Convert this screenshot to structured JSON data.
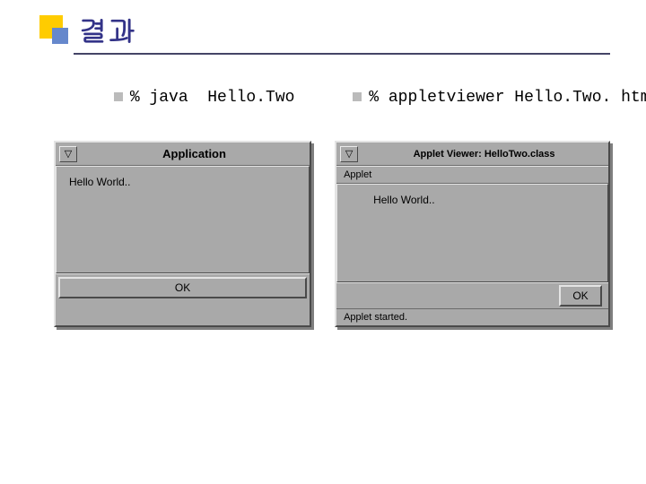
{
  "title": "결과",
  "commands": {
    "left": "% java  Hello.Two",
    "right": "% appletviewer Hello.Two. html"
  },
  "leftWindow": {
    "title": "Application",
    "sysmenuGlyph": "▽",
    "body": "Hello World..",
    "okLabel": "OK"
  },
  "rightWindow": {
    "title": "Applet Viewer: HelloTwo.class",
    "sysmenuGlyph": "▽",
    "menu": "Applet",
    "body": "Hello World..",
    "okLabel": "OK",
    "status": "Applet started."
  }
}
